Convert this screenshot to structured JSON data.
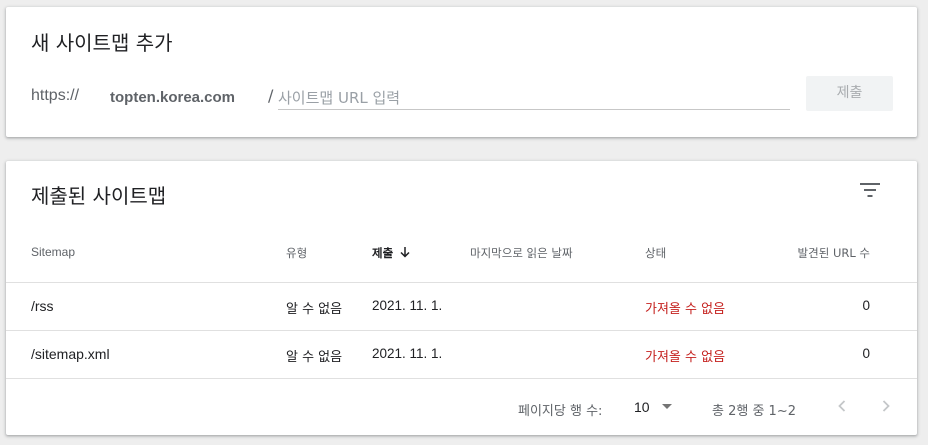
{
  "add_card": {
    "title": "새 사이트맵 추가",
    "prefix": "https://",
    "domain": "topten.korea.com",
    "separator": "/",
    "input_placeholder": "사이트맵 URL 입력",
    "input_value": "",
    "submit_label": "제출"
  },
  "list_card": {
    "title": "제출된 사이트맵",
    "filter_icon": "filter-list-icon",
    "columns": {
      "sitemap": "Sitemap",
      "type": "유형",
      "submitted": "제출",
      "last_read": "마지막으로 읽은 날짜",
      "status": "상태",
      "found_urls": "발견된 URL 수"
    },
    "sort_icon": "arrow-down-icon",
    "rows": [
      {
        "sitemap": "/rss",
        "type": "알 수 없음",
        "submitted": "2021. 11. 1.",
        "last_read": "",
        "status": "가져올 수 없음",
        "found_urls": "0"
      },
      {
        "sitemap": "/sitemap.xml",
        "type": "알 수 없음",
        "submitted": "2021. 11. 1.",
        "last_read": "",
        "status": "가져올 수 없음",
        "found_urls": "0"
      }
    ],
    "pagination": {
      "rows_per_page_label": "페이지당 행 수:",
      "rows_per_page_value": "10",
      "range_label": "총 2행 중 1~2",
      "prev_icon": "chevron-left-icon",
      "next_icon": "chevron-right-icon"
    }
  },
  "colors": {
    "error_status": "#c5221f",
    "muted_text": "#5f6368",
    "background": "#eeeeee"
  }
}
